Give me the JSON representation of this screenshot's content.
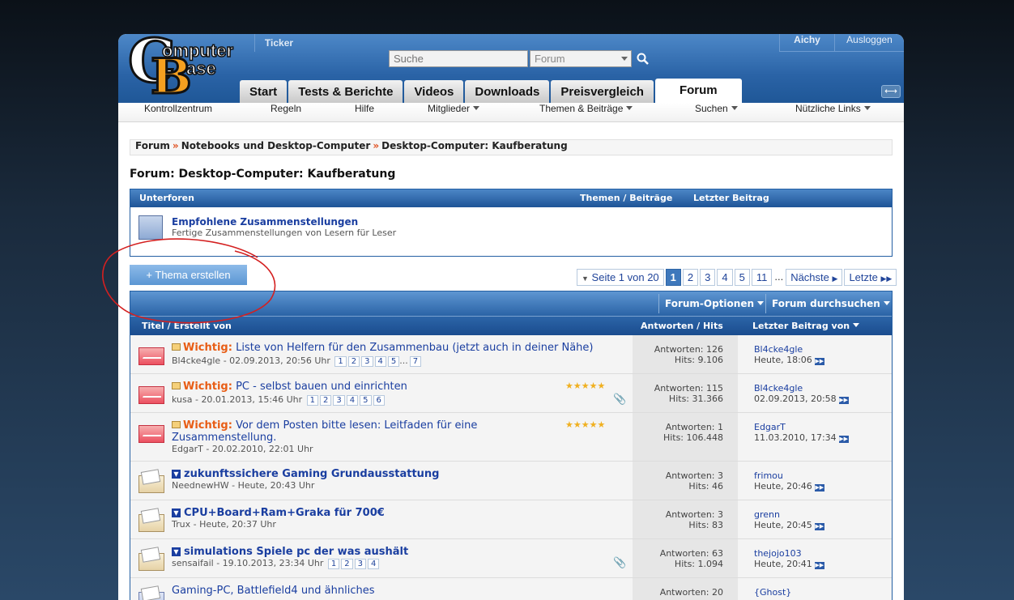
{
  "header": {
    "logo_letters": [
      "C",
      "omputer",
      "B",
      "ase"
    ],
    "ticker": "Ticker",
    "search_placeholder": "Suche",
    "scope_selected": "Forum",
    "user": "Aichy",
    "logout": "Ausloggen",
    "tabs": [
      "Start",
      "Tests & Berichte",
      "Videos",
      "Downloads",
      "Preisvergleich",
      "Forum"
    ],
    "active_tab": "Forum"
  },
  "subnav": [
    "Kontrollzentrum",
    "Regeln",
    "Hilfe",
    "Mitglieder",
    "Themen & Beiträge",
    "Suchen",
    "Nützliche Links"
  ],
  "breadcrumb": [
    "Forum",
    "Notebooks und Desktop-Computer",
    "Desktop-Computer: Kaufberatung"
  ],
  "breadcrumb_sep": "»",
  "forum_title": "Forum: Desktop-Computer: Kaufberatung",
  "subforums": {
    "head": [
      "Unterforen",
      "Themen / Beiträge",
      "Letzter Beitrag"
    ],
    "item": {
      "title": "Empfohlene Zusammenstellungen",
      "desc": "Fertige Zusammenstellungen von Lesern für Leser"
    }
  },
  "new_thread": "+ Thema erstellen",
  "pager": {
    "label": "Seite 1 von 20",
    "pages": [
      "1",
      "2",
      "3",
      "4",
      "5",
      "11"
    ],
    "current": "1",
    "dots": "...",
    "next": "Nächste",
    "last": "Letzte"
  },
  "options": [
    "Forum-Optionen",
    "Forum durchsuchen"
  ],
  "columns": [
    "Titel / Erstellt von",
    "Antworten / Hits",
    "Letzter Beitrag von"
  ],
  "threads": [
    {
      "sticky": "Wichtig:",
      "title": "Liste von Helfern für den Zusammenbau (jetzt auch in deiner Nähe)",
      "by": "Bl4cke4gle - 02.09.2013, 20:56 Uhr",
      "pages": [
        "1",
        "2",
        "3",
        "4",
        "5",
        "...",
        "7"
      ],
      "replies": "Antworten: 126",
      "hits": "Hits: 9.106",
      "last_user": "Bl4cke4gle",
      "last_time": "Heute, 18:06"
    },
    {
      "sticky": "Wichtig:",
      "title": "PC - selbst bauen und einrichten",
      "by": "kusa - 20.01.2013, 15:46 Uhr",
      "pages": [
        "1",
        "2",
        "3",
        "4",
        "5",
        "6"
      ],
      "stars": "★★★★★",
      "replies": "Antworten: 115",
      "hits": "Hits: 31.366",
      "last_user": "Bl4cke4gle",
      "last_time": "02.09.2013, 20:58"
    },
    {
      "sticky": "Wichtig:",
      "title": "Vor dem Posten bitte lesen: Leitfaden für eine",
      "title2": "Zusammenstellung.",
      "by": "EdgarT - 20.02.2010, 22:01 Uhr",
      "stars": "★★★★★",
      "replies": "Antworten: 1",
      "hits": "Hits: 106.448",
      "last_user": "EdgarT",
      "last_time": "11.03.2010, 17:34"
    },
    {
      "title": "zukunftssichere Gaming Grundausstattung",
      "by": "NeednewHW - Heute, 20:43 Uhr",
      "replies": "Antworten: 3",
      "hits": "Hits: 46",
      "last_user": "frimou",
      "last_time": "Heute, 20:46"
    },
    {
      "title": "CPU+Board+Ram+Graka für 700€",
      "by": "Trux - Heute, 20:37 Uhr",
      "replies": "Antworten: 3",
      "hits": "Hits: 83",
      "last_user": "grenn",
      "last_time": "Heute, 20:45"
    },
    {
      "title": "simulations Spiele pc der was aushält",
      "by": "sensaifail - 19.10.2013, 23:34 Uhr",
      "pages": [
        "1",
        "2",
        "3",
        "4"
      ],
      "replies": "Antworten: 63",
      "hits": "Hits: 1.094",
      "last_user": "thejojo103",
      "last_time": "Heute, 20:41"
    },
    {
      "title": "Gaming-PC, Battlefield4 und ähnliches",
      "replies": "Antworten: 20",
      "last_user": "{Ghost}"
    }
  ]
}
